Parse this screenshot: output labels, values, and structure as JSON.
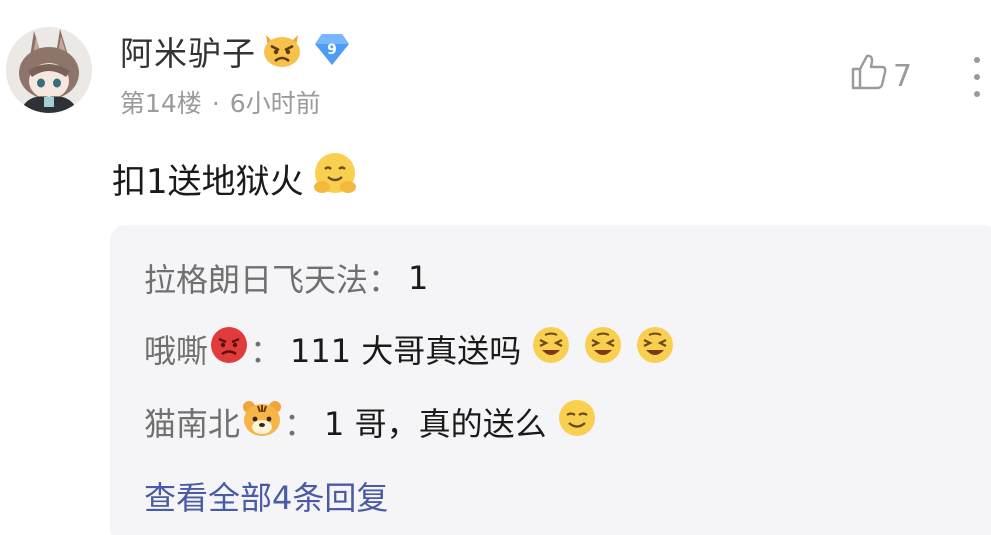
{
  "comment": {
    "username": "阿米驴子",
    "level": "9",
    "floor": "第14楼",
    "separator": "·",
    "time": "6小时前",
    "like_count": "7",
    "content": "扣1送地狱火"
  },
  "replies": [
    {
      "name": "拉格朗日飞天法",
      "colon": "：",
      "text": "1"
    },
    {
      "name": "哦嘶",
      "colon": "：",
      "text": "111 大哥真送吗"
    },
    {
      "name": "猫南北",
      "colon": "：",
      "text": "1 哥，真的送么"
    }
  ],
  "view_all_label": "查看全部4条回复",
  "colors": {
    "username": "#333333",
    "meta": "#9a9a9a",
    "reply_bg": "#f5f5f7",
    "reply_name": "#707070",
    "link": "#4a5ba6",
    "level_badge": "#4f9cf7"
  }
}
